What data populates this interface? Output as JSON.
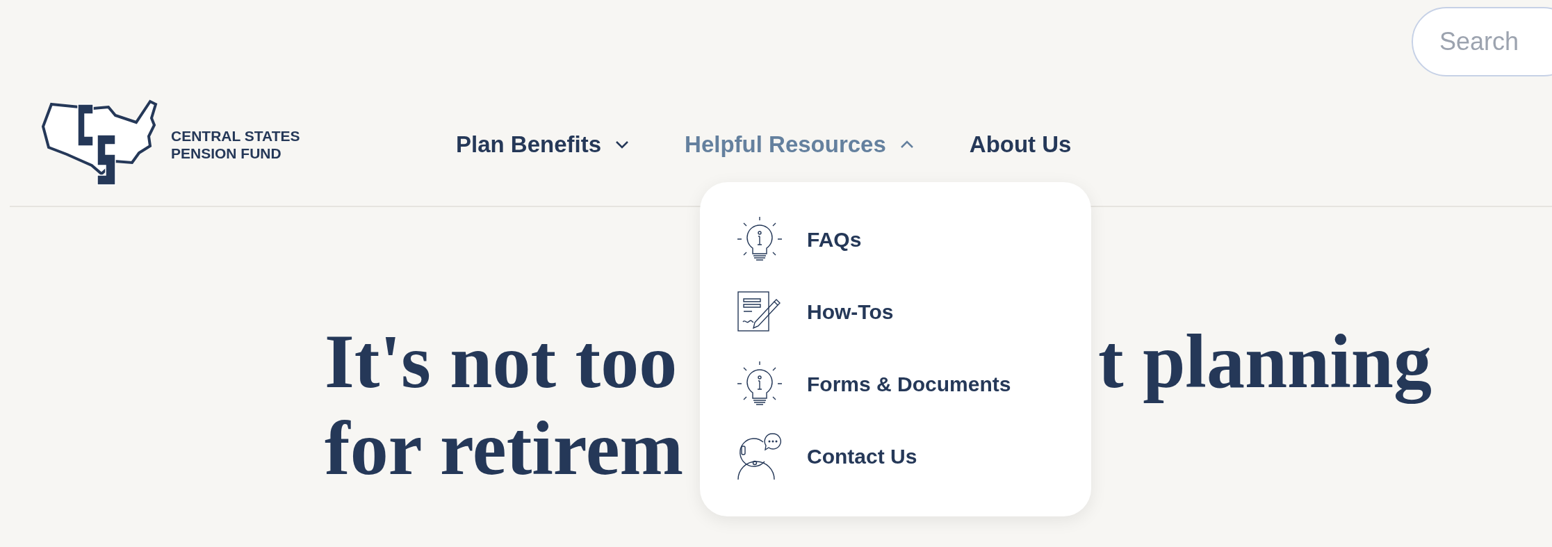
{
  "search": {
    "placeholder": "Search"
  },
  "logo": {
    "lines": [
      "CENTRAL STATES",
      "PENSION FUND"
    ]
  },
  "nav": [
    {
      "label": "Plan Benefits",
      "kind": "menu",
      "expanded": false
    },
    {
      "label": "Helpful Resources",
      "kind": "menu",
      "expanded": true
    },
    {
      "label": "About Us",
      "kind": "link"
    }
  ],
  "dropdown": [
    {
      "label": "FAQs"
    },
    {
      "label": "How-Tos"
    },
    {
      "label": "Forms & Documents"
    },
    {
      "label": "Contact Us"
    }
  ],
  "headline": [
    {
      "left": "It's not too",
      "right": "t planning"
    },
    {
      "left": "for retirem"
    }
  ]
}
